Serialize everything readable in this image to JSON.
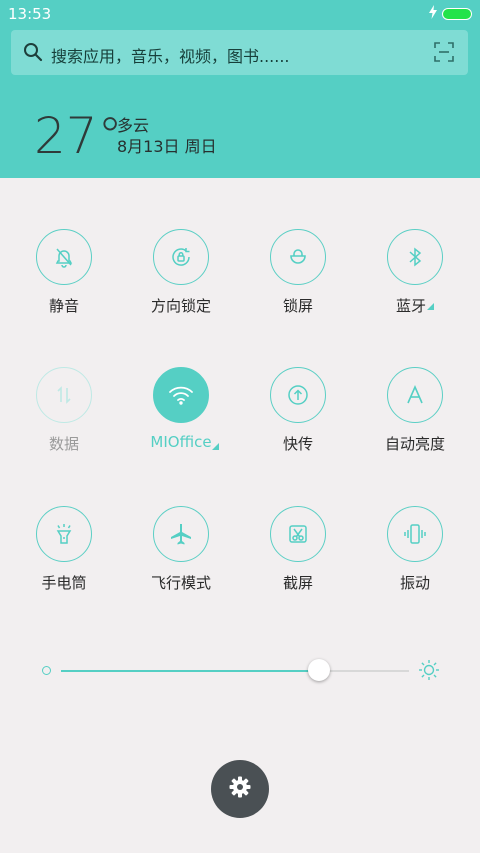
{
  "status_bar": {
    "time": "13:53"
  },
  "search": {
    "placeholder": "搜索应用，音乐，视频，图书......"
  },
  "weather": {
    "temperature": "27°",
    "condition": "多云",
    "date": "8月13日 周日"
  },
  "toggles": [
    {
      "label": "静音",
      "icon": "bell-off-icon"
    },
    {
      "label": "方向锁定",
      "icon": "rotation-lock-icon"
    },
    {
      "label": "锁屏",
      "icon": "lock-icon"
    },
    {
      "label": "蓝牙",
      "icon": "bluetooth-icon",
      "expandable": true
    },
    {
      "label": "数据",
      "icon": "data-arrows-icon",
      "state": "disabled"
    },
    {
      "label": "MIOffice",
      "icon": "wifi-icon",
      "state": "on",
      "expandable": true
    },
    {
      "label": "快传",
      "icon": "share-upload-icon"
    },
    {
      "label": "自动亮度",
      "icon": "auto-brightness-icon"
    },
    {
      "label": "手电筒",
      "icon": "flashlight-icon"
    },
    {
      "label": "飞行模式",
      "icon": "airplane-icon"
    },
    {
      "label": "截屏",
      "icon": "screenshot-icon"
    },
    {
      "label": "振动",
      "icon": "vibrate-icon"
    }
  ],
  "brightness": {
    "level": 0.74
  },
  "colors": {
    "accent": "#55cfc4",
    "panel_bg": "#f2eff0",
    "settings_button": "#4a5054"
  }
}
